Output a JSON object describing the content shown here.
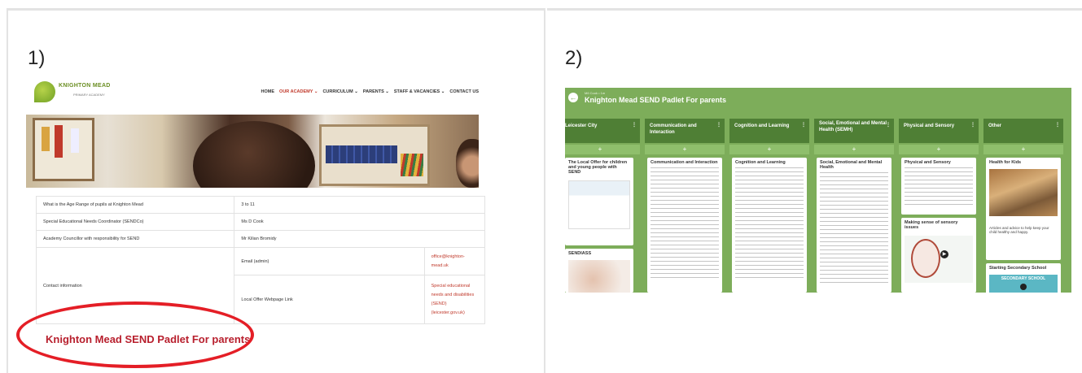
{
  "left": {
    "number": "1)",
    "logo_text": "KNIGHTON MEAD",
    "logo_subtext": "PRIMARY ACADEMY",
    "nav": [
      {
        "label": "HOME",
        "active": false
      },
      {
        "label": "OUR ACADEMY ⌄",
        "active": true
      },
      {
        "label": "CURRICULUM ⌄",
        "active": false
      },
      {
        "label": "PARENTS ⌄",
        "active": false
      },
      {
        "label": "STAFF & VACANCIES ⌄",
        "active": false
      },
      {
        "label": "CONTACT US",
        "active": false
      }
    ],
    "table": {
      "r1_label": "What is the Age Range of pupils at Knighton Mead",
      "r1_value": "3 to 11",
      "r2_label": "Special Educational Needs Coordinator (SENDCo)",
      "r2_value": "Ms D Cook",
      "r3_label": "Academy Councillor with responsibility for SEND",
      "r3_value": "Mr Kilian Bromidy",
      "contact_label": "Contact information",
      "email_label": "Email (admin)",
      "email_value": "office@knighton-mead.uk",
      "offer_label": "Local Offer Webpage Link",
      "offer_value": "Special educational needs and disabilities (SEND) (leicester.gov.uk)"
    },
    "padlet_link": "Knighton Mead SEND Padlet For parents",
    "highlight_color": "#e41e26"
  },
  "right": {
    "number": "2)",
    "breadcrumb": "M6 Cook • 1m",
    "title": "Knighton Mead SEND Padlet For parents",
    "back_icon": "←",
    "columns": [
      {
        "header": "Leicester City",
        "card_title": "The Local Offer for children and young people with SEND",
        "card2_title": "SENDIASS"
      },
      {
        "header": "Communication and Interaction",
        "card_title": "Communication and Interaction",
        "card2_title": ""
      },
      {
        "header": "Cognition and Learning",
        "card_title": "Cognition and Learning",
        "card2_title": ""
      },
      {
        "header": "Social, Emotional and Mental Health (SEMH)",
        "card_title": "Social, Emotional and Mental Health",
        "card2_title": ""
      },
      {
        "header": "Physical and Sensory",
        "card_title": "Physical and Sensory",
        "card2_title": "Making sense of sensory issues"
      },
      {
        "header": "Other",
        "card_title": "Health for Kids",
        "card2_title": "Starting Secondary School"
      }
    ],
    "other_card_text": "Articles and advice to help keep your child healthy and happy.",
    "starting_banner": "SECONDARY SCHOOL",
    "padlet_color": "#7dad5a"
  }
}
